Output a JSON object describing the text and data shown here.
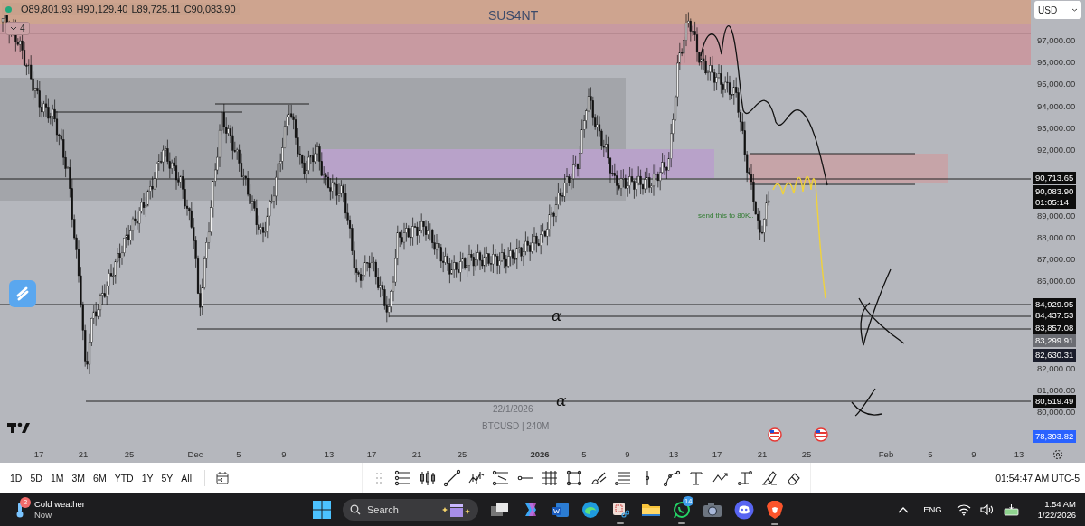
{
  "legend": {
    "open": "O89,801.93",
    "high": "H90,129.40",
    "low": "L89,725.11",
    "close": "C90,083.90"
  },
  "indicators_toggle": {
    "label": "4"
  },
  "currency": "USD",
  "chart_title": "SUS4NT",
  "note": "send this to 80K..",
  "annotations": [
    "α",
    "α"
  ],
  "watermark": {
    "date": "22/1/2026",
    "symbol": "BTCUSD | 240M"
  },
  "price_ticks": [
    "97,000.00",
    "96,000.00",
    "95,000.00",
    "94,000.00",
    "93,000.00",
    "92,000.00",
    "89,000.00",
    "88,000.00",
    "87,000.00",
    "86,000.00",
    "82,000.00",
    "81,000.00",
    "80,000.00"
  ],
  "price_labels": [
    {
      "text": "90,713.65",
      "kind": "line"
    },
    {
      "text": "90,083.90",
      "countdown": "01:05:14",
      "kind": "last"
    },
    {
      "text": "84,929.95",
      "kind": "line"
    },
    {
      "text": "84,437.53",
      "kind": "line"
    },
    {
      "text": "83,857.08",
      "kind": "line"
    },
    {
      "text": "83,299.91",
      "kind": "crosshair"
    },
    {
      "text": "82,630.31",
      "kind": "range"
    },
    {
      "text": "80,519.49",
      "kind": "line"
    },
    {
      "text": "78,393.82",
      "kind": "marker"
    }
  ],
  "time_ticks": [
    {
      "label": "17",
      "major": false
    },
    {
      "label": "21",
      "major": false
    },
    {
      "label": "25",
      "major": false
    },
    {
      "label": "Dec",
      "major": false
    },
    {
      "label": "5",
      "major": false
    },
    {
      "label": "9",
      "major": false
    },
    {
      "label": "13",
      "major": false
    },
    {
      "label": "17",
      "major": false
    },
    {
      "label": "21",
      "major": false
    },
    {
      "label": "25",
      "major": false
    },
    {
      "label": "2026",
      "major": true
    },
    {
      "label": "5",
      "major": false
    },
    {
      "label": "9",
      "major": false
    },
    {
      "label": "13",
      "major": false
    },
    {
      "label": "17",
      "major": false
    },
    {
      "label": "21",
      "major": false
    },
    {
      "label": "25",
      "major": false
    },
    {
      "label": "Feb",
      "major": false
    },
    {
      "label": "5",
      "major": false
    },
    {
      "label": "9",
      "major": false
    },
    {
      "label": "13",
      "major": false
    }
  ],
  "range_buttons": [
    "1D",
    "5D",
    "1M",
    "3M",
    "6M",
    "YTD",
    "1Y",
    "5Y",
    "All"
  ],
  "clock": "01:54:47 AM UTC-5",
  "taskbar": {
    "weather": {
      "badge": "2",
      "title": "Cold weather",
      "subtitle": "Now"
    },
    "search_placeholder": "Search",
    "whatsapp_badge": "14",
    "language": "ENG",
    "time": "1:54 AM",
    "date": "1/22/2026"
  }
}
